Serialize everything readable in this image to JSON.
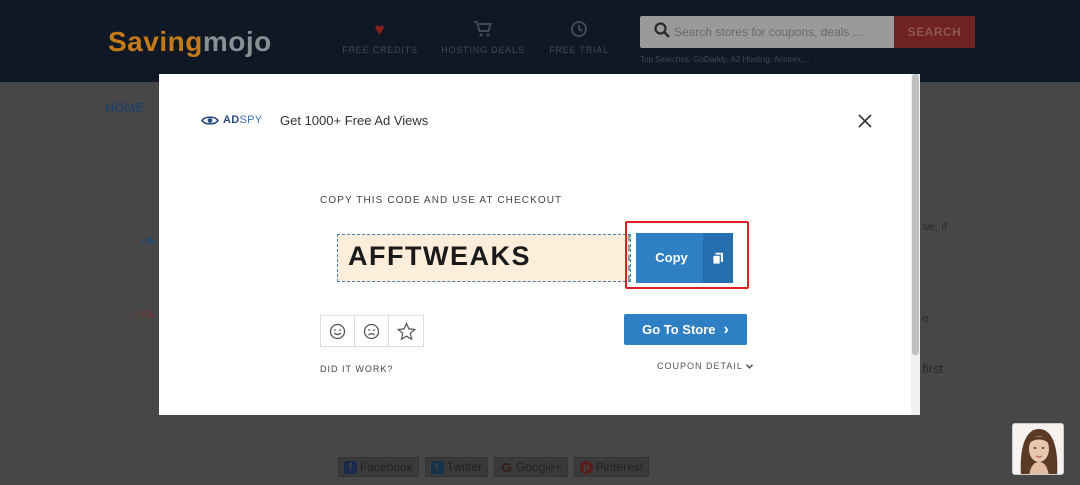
{
  "site": {
    "logo_part1": "Saving",
    "logo_part2": "mojo",
    "nav": [
      {
        "label": "FREE CREDITS",
        "icon": "heart-icon"
      },
      {
        "label": "HOSTING DEALS",
        "icon": "cart-icon"
      },
      {
        "label": "FREE TRIAL",
        "icon": "clock-icon"
      }
    ],
    "search_placeholder": "Search stores for coupons, deals ...",
    "search_button": "SEARCH",
    "top_searches": "Top Searches:   GoDaddy,  A2 Hosting,  Anstrex,...",
    "breadcrumb_home": "HOME",
    "fav_label": "FA",
    "side_text_1": "se, it",
    "side_text_2": "e",
    "side_text_3": "first",
    "share": [
      {
        "label": "Facebook",
        "icon": "facebook-icon"
      },
      {
        "label": "Twitter",
        "icon": "twitter-icon"
      },
      {
        "label": "Google+",
        "icon": "google-icon"
      },
      {
        "label": "Pinterest",
        "icon": "pinterest-icon"
      }
    ]
  },
  "modal": {
    "ad_logo_1": "AD",
    "ad_logo_2": "SPY",
    "ad_text": "Get 1000+ Free Ad Views",
    "copy_instruction": "COPY THIS CODE AND USE AT CHECKOUT",
    "coupon_code": "AFFTWEAKS",
    "copy_button": "Copy",
    "go_to_store": "Go To Store",
    "go_to_store_arrow": "›",
    "did_it_work": "DID IT WORK?",
    "coupon_detail": "COUPON DETAIL",
    "colors": {
      "primary": "#2f7fc4",
      "highlight": "#e02020",
      "code_bg": "#fdeedb"
    }
  }
}
